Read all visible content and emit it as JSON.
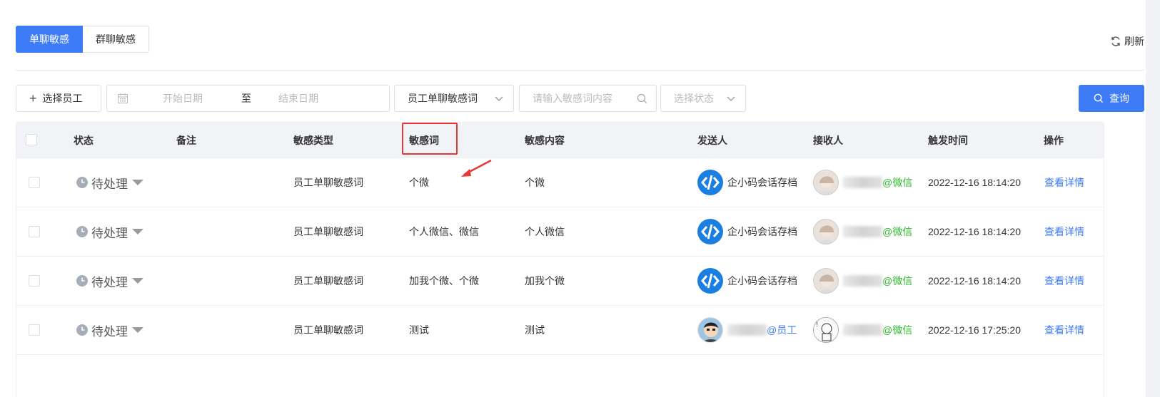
{
  "tabs": [
    {
      "label": "单聊敏感",
      "active": true
    },
    {
      "label": "群聊敏感",
      "active": false
    }
  ],
  "refresh_label": "刷新",
  "filters": {
    "select_staff": "选择员工",
    "start_placeholder": "开始日期",
    "range_sep": "至",
    "end_placeholder": "结束日期",
    "type_value": "员工单聊敏感词",
    "keyword_placeholder": "请输入敏感词内容",
    "status_placeholder": "选择状态",
    "query_label": "查询"
  },
  "columns": [
    "状态",
    "备注",
    "敏感类型",
    "敏感词",
    "敏感内容",
    "发送人",
    "接收人",
    "触发时间",
    "操作"
  ],
  "rows": [
    {
      "status": "待处理",
      "note": "",
      "type": "员工单聊敏感词",
      "word": "个微",
      "content": "个微",
      "sender_avatar": "bot-icon",
      "sender_name": "企小码会话存档",
      "sender_tag": "",
      "receiver_avatar": "girl-avatar",
      "receiver_tag": "@微信",
      "time": "2022-12-16 18:14:20",
      "action": "查看详情"
    },
    {
      "status": "待处理",
      "note": "",
      "type": "员工单聊敏感词",
      "word": "个人微信、微信",
      "content": "个人微信",
      "sender_avatar": "bot-icon",
      "sender_name": "企小码会话存档",
      "sender_tag": "",
      "receiver_avatar": "girl-avatar",
      "receiver_tag": "@微信",
      "time": "2022-12-16 18:14:20",
      "action": "查看详情"
    },
    {
      "status": "待处理",
      "note": "",
      "type": "员工单聊敏感词",
      "word": "加我个微、个微",
      "content": "加我个微",
      "sender_avatar": "bot-icon",
      "sender_name": "企小码会话存档",
      "sender_tag": "",
      "receiver_avatar": "girl-avatar",
      "receiver_tag": "@微信",
      "time": "2022-12-16 18:14:20",
      "action": "查看详情"
    },
    {
      "status": "待处理",
      "note": "",
      "type": "员工单聊敏感词",
      "word": "测试",
      "content": "测试",
      "sender_avatar": "boy-avatar",
      "sender_name": "",
      "sender_tag": "@员工",
      "receiver_avatar": "sketch-avatar",
      "receiver_tag": "@微信",
      "time": "2022-12-16 17:25:20",
      "action": "查看详情"
    }
  ],
  "colors": {
    "primary": "#3e7bf6",
    "wechat_green": "#2eb82e",
    "highlight_red": "#e53935"
  }
}
